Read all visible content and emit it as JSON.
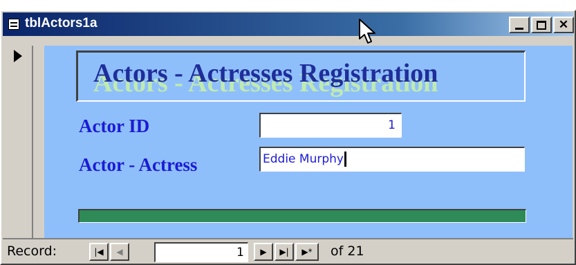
{
  "window": {
    "title": "tblActors1a",
    "icon": "datasheet-icon",
    "buttons": {
      "minimize": "minimize-icon",
      "maximize": "maximize-icon",
      "close": "✕"
    }
  },
  "form": {
    "banner_title": "Actors - Actresses Registration",
    "fields": {
      "actor_id_label": "Actor ID",
      "actor_id_value": "1",
      "actor_name_label": "Actor - Actress",
      "actor_name_value": "Eddie Murphy"
    },
    "colors": {
      "form_background": "#8fbffa",
      "label_text": "#1b1bd6",
      "banner_text": "#1f2e9a",
      "banner_shadow": "#c6f0a8",
      "status_bar": "#2e8b57"
    }
  },
  "navigation": {
    "record_label": "Record:",
    "current_record": "1",
    "of_label": "of",
    "total_records": "21",
    "buttons": {
      "first": "|◀",
      "prev": "◀",
      "next": "▶",
      "last": "▶|",
      "new": "▶*"
    }
  }
}
